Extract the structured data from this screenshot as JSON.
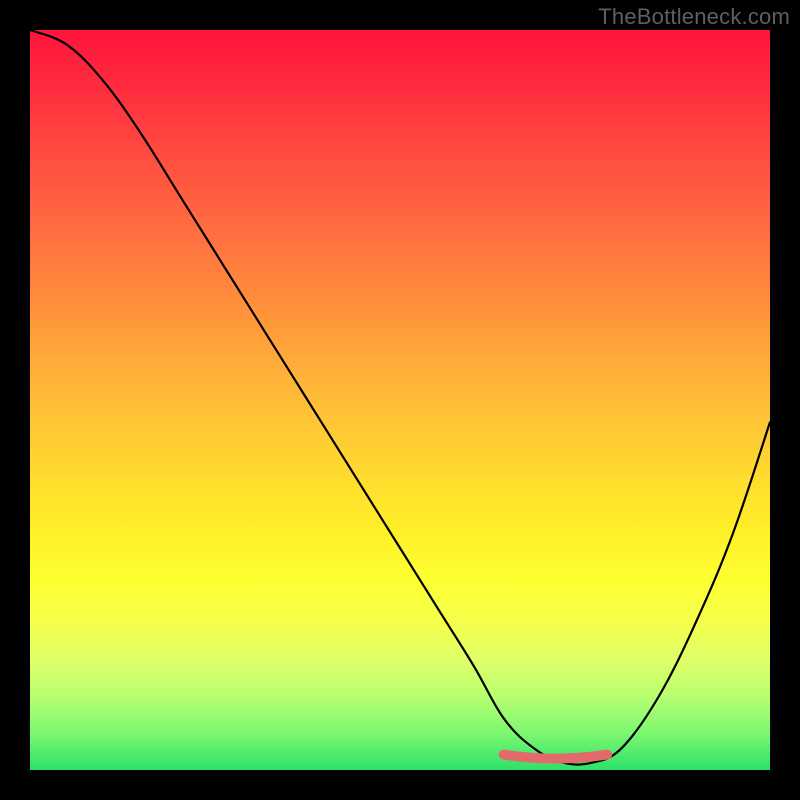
{
  "watermark": "TheBottleneck.com",
  "chart_data": {
    "type": "line",
    "title": "",
    "xlabel": "",
    "ylabel": "",
    "xlim": [
      0,
      100
    ],
    "ylim": [
      0,
      100
    ],
    "series": [
      {
        "name": "curve",
        "x": [
          0,
          5,
          10,
          15,
          20,
          25,
          30,
          35,
          40,
          45,
          50,
          55,
          60,
          64,
          68,
          72,
          76,
          80,
          85,
          90,
          95,
          100
        ],
        "values": [
          100,
          98,
          93,
          86,
          78,
          70,
          62,
          54,
          46,
          38,
          30,
          22,
          14,
          7,
          3,
          1,
          1,
          3,
          10,
          20,
          32,
          47
        ]
      }
    ],
    "flat_region": {
      "x_start": 64,
      "x_end": 78,
      "y": 1
    },
    "gradient_top_color": "#ff143c",
    "gradient_bottom_color": "#2fe06a"
  }
}
